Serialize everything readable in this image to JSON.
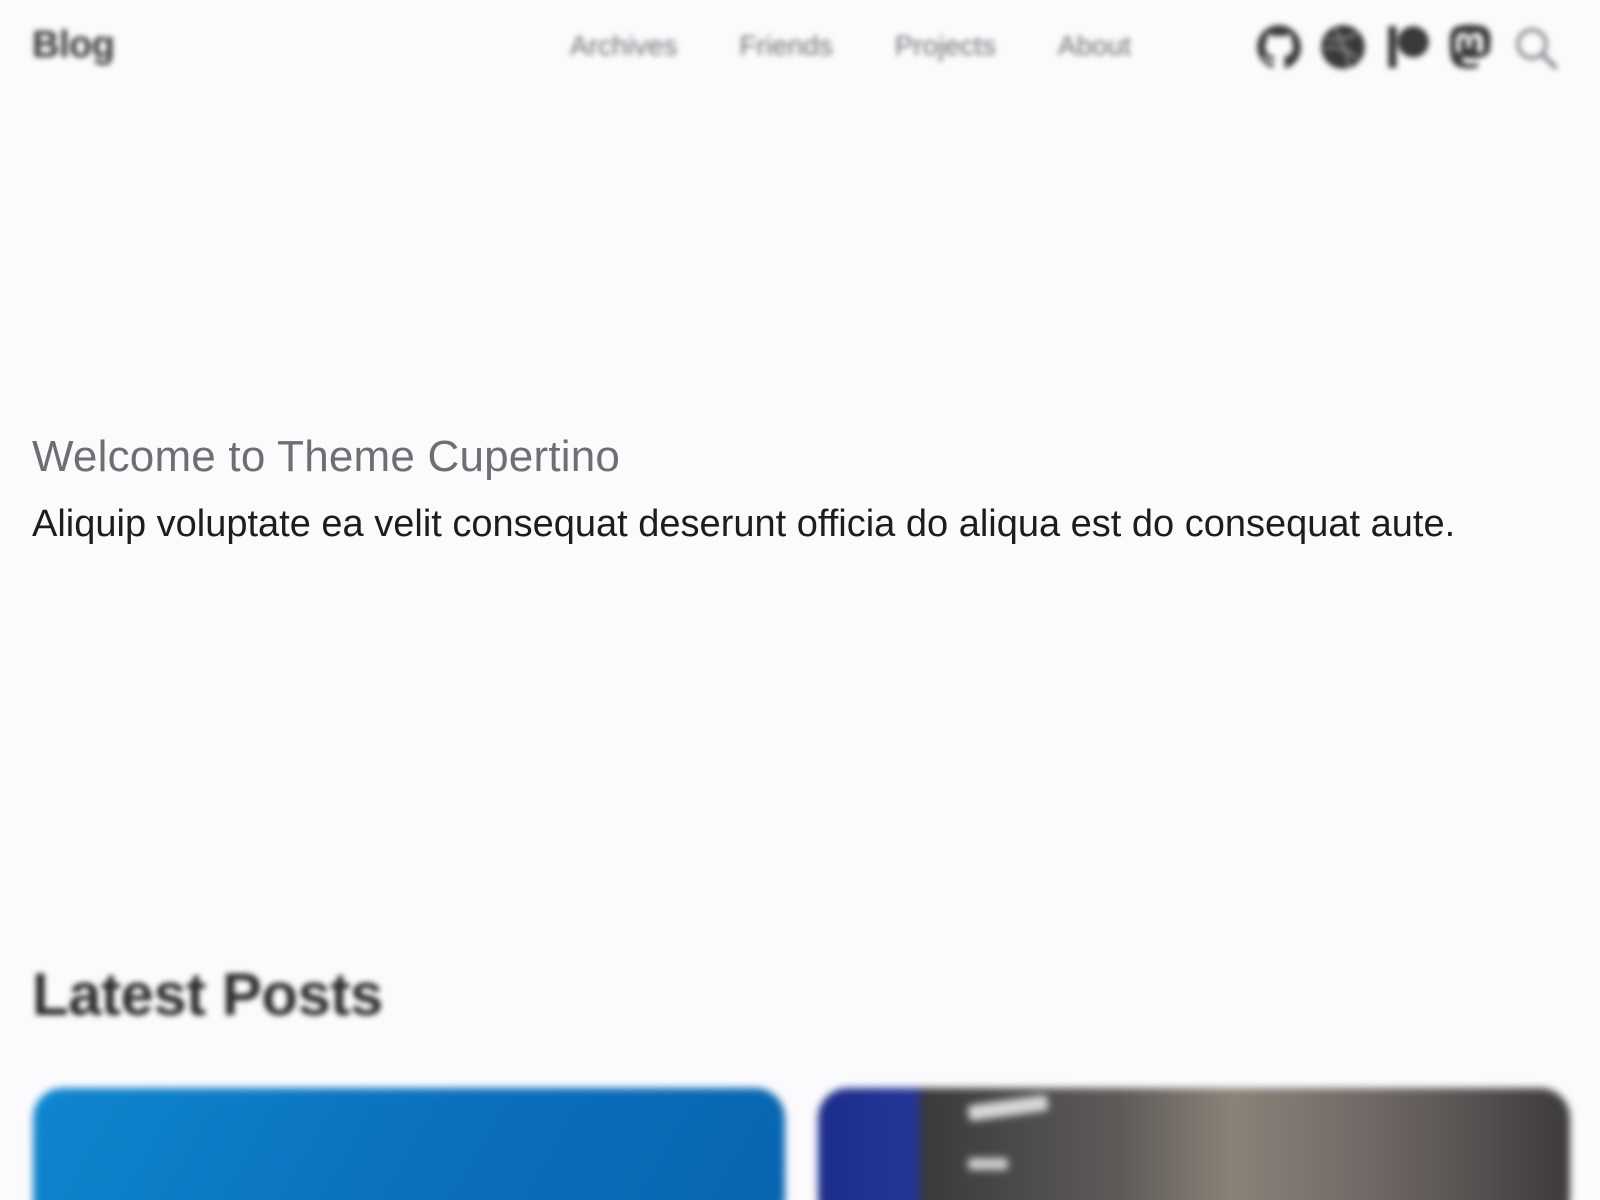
{
  "header": {
    "brand": "Blog",
    "nav": [
      {
        "label": "Archives"
      },
      {
        "label": "Friends"
      },
      {
        "label": "Projects"
      },
      {
        "label": "About"
      }
    ],
    "social_icons": [
      "github-icon",
      "dribbble-icon",
      "patreon-icon",
      "mastodon-icon"
    ],
    "search_icon": "search-icon"
  },
  "hero": {
    "title": "Welcome to Theme Cupertino",
    "subtitle": "Aliquip voluptate ea velit consequat deserunt officia do aliqua est do consequat aute."
  },
  "latest": {
    "title": "Latest Posts"
  },
  "colors": {
    "background": "#fbfbfd",
    "text": "#1d1d1f",
    "muted": "#6e6e73",
    "card1": "#0a6fbd",
    "card2_accent": "#243598"
  }
}
